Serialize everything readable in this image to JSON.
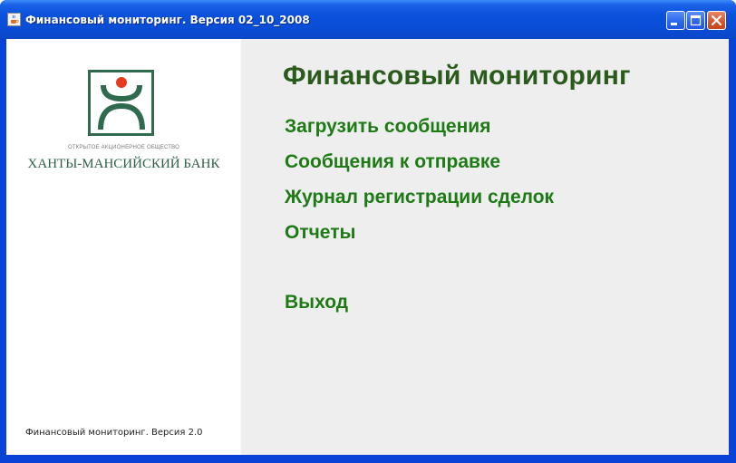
{
  "window": {
    "title": "Финансовый мониторинг. Версия 02_10_2008",
    "app_icon": "java-cup-icon",
    "controls": {
      "minimize": "minimize-icon",
      "maximize": "maximize-icon",
      "close": "close-icon"
    }
  },
  "sidebar": {
    "logo_icon": "khanty-mansiysk-bank-logo",
    "org_type": "ОТКРЫТОЕ АКЦИОНЕРНОЕ ОБЩЕСТВО",
    "bank_name": "ХАНТЫ-МАНСИЙСКИЙ БАНК",
    "version": "Финансовый мониторинг. Версия 2.0"
  },
  "main": {
    "title": "Финансовый мониторинг",
    "menu": [
      {
        "label": "Загрузить сообщения"
      },
      {
        "label": "Сообщения к отправке"
      },
      {
        "label": "Журнал регистрации сделок"
      },
      {
        "label": "Отчеты"
      },
      {
        "label": "Выход"
      }
    ]
  },
  "colors": {
    "titlebar": "#0a4ed6",
    "heading_green": "#2a5a1c",
    "link_green": "#1e7a14",
    "logo_green": "#2f5f49",
    "logo_red": "#e63a1e",
    "panel_bg": "#eeeeee"
  }
}
